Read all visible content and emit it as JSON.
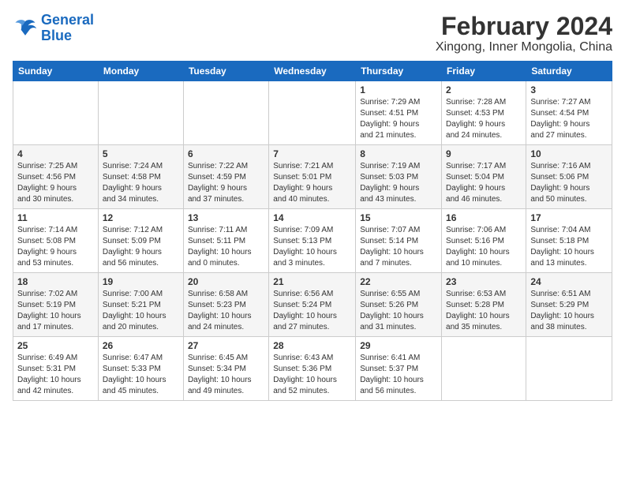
{
  "logo": {
    "line1": "General",
    "line2": "Blue"
  },
  "title": "February 2024",
  "subtitle": "Xingong, Inner Mongolia, China",
  "weekdays": [
    "Sunday",
    "Monday",
    "Tuesday",
    "Wednesday",
    "Thursday",
    "Friday",
    "Saturday"
  ],
  "weeks": [
    [
      {
        "day": "",
        "info": ""
      },
      {
        "day": "",
        "info": ""
      },
      {
        "day": "",
        "info": ""
      },
      {
        "day": "",
        "info": ""
      },
      {
        "day": "1",
        "info": "Sunrise: 7:29 AM\nSunset: 4:51 PM\nDaylight: 9 hours\nand 21 minutes."
      },
      {
        "day": "2",
        "info": "Sunrise: 7:28 AM\nSunset: 4:53 PM\nDaylight: 9 hours\nand 24 minutes."
      },
      {
        "day": "3",
        "info": "Sunrise: 7:27 AM\nSunset: 4:54 PM\nDaylight: 9 hours\nand 27 minutes."
      }
    ],
    [
      {
        "day": "4",
        "info": "Sunrise: 7:25 AM\nSunset: 4:56 PM\nDaylight: 9 hours\nand 30 minutes."
      },
      {
        "day": "5",
        "info": "Sunrise: 7:24 AM\nSunset: 4:58 PM\nDaylight: 9 hours\nand 34 minutes."
      },
      {
        "day": "6",
        "info": "Sunrise: 7:22 AM\nSunset: 4:59 PM\nDaylight: 9 hours\nand 37 minutes."
      },
      {
        "day": "7",
        "info": "Sunrise: 7:21 AM\nSunset: 5:01 PM\nDaylight: 9 hours\nand 40 minutes."
      },
      {
        "day": "8",
        "info": "Sunrise: 7:19 AM\nSunset: 5:03 PM\nDaylight: 9 hours\nand 43 minutes."
      },
      {
        "day": "9",
        "info": "Sunrise: 7:17 AM\nSunset: 5:04 PM\nDaylight: 9 hours\nand 46 minutes."
      },
      {
        "day": "10",
        "info": "Sunrise: 7:16 AM\nSunset: 5:06 PM\nDaylight: 9 hours\nand 50 minutes."
      }
    ],
    [
      {
        "day": "11",
        "info": "Sunrise: 7:14 AM\nSunset: 5:08 PM\nDaylight: 9 hours\nand 53 minutes."
      },
      {
        "day": "12",
        "info": "Sunrise: 7:12 AM\nSunset: 5:09 PM\nDaylight: 9 hours\nand 56 minutes."
      },
      {
        "day": "13",
        "info": "Sunrise: 7:11 AM\nSunset: 5:11 PM\nDaylight: 10 hours\nand 0 minutes."
      },
      {
        "day": "14",
        "info": "Sunrise: 7:09 AM\nSunset: 5:13 PM\nDaylight: 10 hours\nand 3 minutes."
      },
      {
        "day": "15",
        "info": "Sunrise: 7:07 AM\nSunset: 5:14 PM\nDaylight: 10 hours\nand 7 minutes."
      },
      {
        "day": "16",
        "info": "Sunrise: 7:06 AM\nSunset: 5:16 PM\nDaylight: 10 hours\nand 10 minutes."
      },
      {
        "day": "17",
        "info": "Sunrise: 7:04 AM\nSunset: 5:18 PM\nDaylight: 10 hours\nand 13 minutes."
      }
    ],
    [
      {
        "day": "18",
        "info": "Sunrise: 7:02 AM\nSunset: 5:19 PM\nDaylight: 10 hours\nand 17 minutes."
      },
      {
        "day": "19",
        "info": "Sunrise: 7:00 AM\nSunset: 5:21 PM\nDaylight: 10 hours\nand 20 minutes."
      },
      {
        "day": "20",
        "info": "Sunrise: 6:58 AM\nSunset: 5:23 PM\nDaylight: 10 hours\nand 24 minutes."
      },
      {
        "day": "21",
        "info": "Sunrise: 6:56 AM\nSunset: 5:24 PM\nDaylight: 10 hours\nand 27 minutes."
      },
      {
        "day": "22",
        "info": "Sunrise: 6:55 AM\nSunset: 5:26 PM\nDaylight: 10 hours\nand 31 minutes."
      },
      {
        "day": "23",
        "info": "Sunrise: 6:53 AM\nSunset: 5:28 PM\nDaylight: 10 hours\nand 35 minutes."
      },
      {
        "day": "24",
        "info": "Sunrise: 6:51 AM\nSunset: 5:29 PM\nDaylight: 10 hours\nand 38 minutes."
      }
    ],
    [
      {
        "day": "25",
        "info": "Sunrise: 6:49 AM\nSunset: 5:31 PM\nDaylight: 10 hours\nand 42 minutes."
      },
      {
        "day": "26",
        "info": "Sunrise: 6:47 AM\nSunset: 5:33 PM\nDaylight: 10 hours\nand 45 minutes."
      },
      {
        "day": "27",
        "info": "Sunrise: 6:45 AM\nSunset: 5:34 PM\nDaylight: 10 hours\nand 49 minutes."
      },
      {
        "day": "28",
        "info": "Sunrise: 6:43 AM\nSunset: 5:36 PM\nDaylight: 10 hours\nand 52 minutes."
      },
      {
        "day": "29",
        "info": "Sunrise: 6:41 AM\nSunset: 5:37 PM\nDaylight: 10 hours\nand 56 minutes."
      },
      {
        "day": "",
        "info": ""
      },
      {
        "day": "",
        "info": ""
      }
    ]
  ]
}
